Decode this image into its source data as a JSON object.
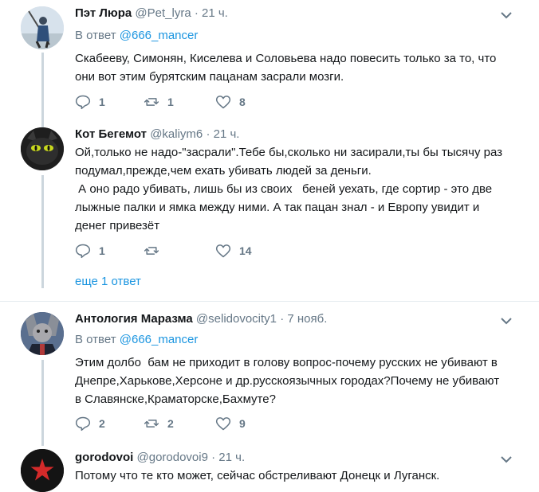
{
  "tweets": [
    {
      "name": "Пэт Люра",
      "handle": "@Pet_lyra",
      "time": "· 21 ч.",
      "reply_prefix": "В ответ",
      "reply_mention": "@666_mancer",
      "text_lines": [
        "Скабееву, Симонян, Киселева и Соловьева надо повесить только за то, что",
        "они вот этим бурятским пацанам засрали мозги."
      ],
      "replies": "1",
      "retweets": "1",
      "likes": "8"
    },
    {
      "name": "Кот Бегемот",
      "handle": "@kaliym6",
      "time": "· 21 ч.",
      "text_lines": [
        "Ой,только не надо-\"засрали\".Тебе бы,сколько ни засирали,ты бы тысячу раз",
        "подумал,прежде,чем ехать убивать людей за деньги.",
        " А оно радо убивать, лишь бы из своих   беней уехать, где сортир - это две",
        "лыжные палки и ямка между ними. А так пацан знал - и Европу увидит и",
        "денег привезёт"
      ],
      "replies": "1",
      "retweets": "",
      "likes": "14",
      "more_replies": "еще 1 ответ"
    },
    {
      "name": "Антология Маразма",
      "handle": "@selidovocity1",
      "time": "· 7 нояб.",
      "reply_prefix": "В ответ",
      "reply_mention": "@666_mancer",
      "text_lines": [
        "Этим долбо  бам не приходит в голову вопрос-почему русских не убивают в",
        "Днепре,Харькове,Херсоне и др.русскоязычных городах?Почему не убивают",
        "в Славянске,Краматорске,Бахмуте?"
      ],
      "replies": "2",
      "retweets": "2",
      "likes": "9"
    },
    {
      "name": "gorodovoi",
      "handle": "@gorodovoi9",
      "time": "· 21 ч.",
      "text_lines": [
        "Потому что те кто может, сейчас обстреливают Донецк и Луганск."
      ]
    }
  ],
  "icons": {
    "reply": "reply-icon",
    "retweet": "retweet-icon",
    "like": "heart-icon",
    "caret": "chevron-down-icon"
  },
  "colors": {
    "link": "#1b95e0",
    "secondary": "#657786",
    "thread_line": "#ccd6dd",
    "divider": "#e6ecf0"
  }
}
